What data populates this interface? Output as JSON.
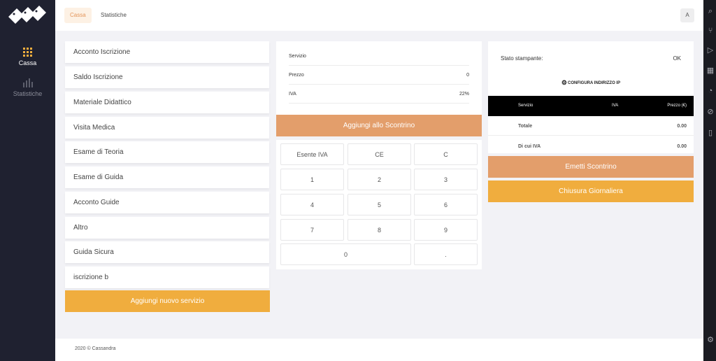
{
  "colors": {
    "sidebar": "#1f2130",
    "accent_orange": "#f0ad3e",
    "accent_salmon": "#e39e6b",
    "active_tab_bg": "#fdf1e4"
  },
  "sidebar": {
    "items": [
      {
        "label": "Cassa",
        "icon": "grid-icon",
        "active": true
      },
      {
        "label": "Statistiche",
        "icon": "bar-chart-icon",
        "active": false
      }
    ]
  },
  "header": {
    "tabs": [
      {
        "label": "Cassa",
        "active": true
      },
      {
        "label": "Statistiche",
        "active": false
      }
    ],
    "avatar": "A"
  },
  "services": [
    "Acconto Iscrizione",
    "Saldo Iscrizione",
    "Materiale Didattico",
    "Visita Medica",
    "Esame di Teoria",
    "Esame di Guida",
    "Acconto Guide",
    "Altro",
    "Guida Sicura",
    "iscrizione b"
  ],
  "add_service_label": "Aggiungi nuovo servizio",
  "item_form": {
    "rows": [
      {
        "label": "Servizio",
        "value": ""
      },
      {
        "label": "Prezzo",
        "value": "0"
      },
      {
        "label": "IVA",
        "value": "22%"
      }
    ],
    "add_button": "Aggiungi allo Scontrino"
  },
  "keypad": {
    "keys": [
      "Esente IVA",
      "CE",
      "C",
      "1",
      "2",
      "3",
      "4",
      "5",
      "6",
      "7",
      "8",
      "9",
      "0",
      "."
    ]
  },
  "receipt": {
    "printer_label": "Stato stampante:",
    "printer_status": "OK",
    "configure_label": "CONFIGURA INDIRIZZO IP",
    "columns": [
      "Servizio",
      "IVA",
      "Prezzo (€)"
    ],
    "totals": [
      {
        "label": "Totale",
        "value": "0.00"
      },
      {
        "label": "Di cui IVA",
        "value": "0.00"
      }
    ],
    "emit_button": "Emetti Scontrino",
    "close_button": "Chiusura Giornaliera"
  },
  "footer": "2020 © Cassandra"
}
